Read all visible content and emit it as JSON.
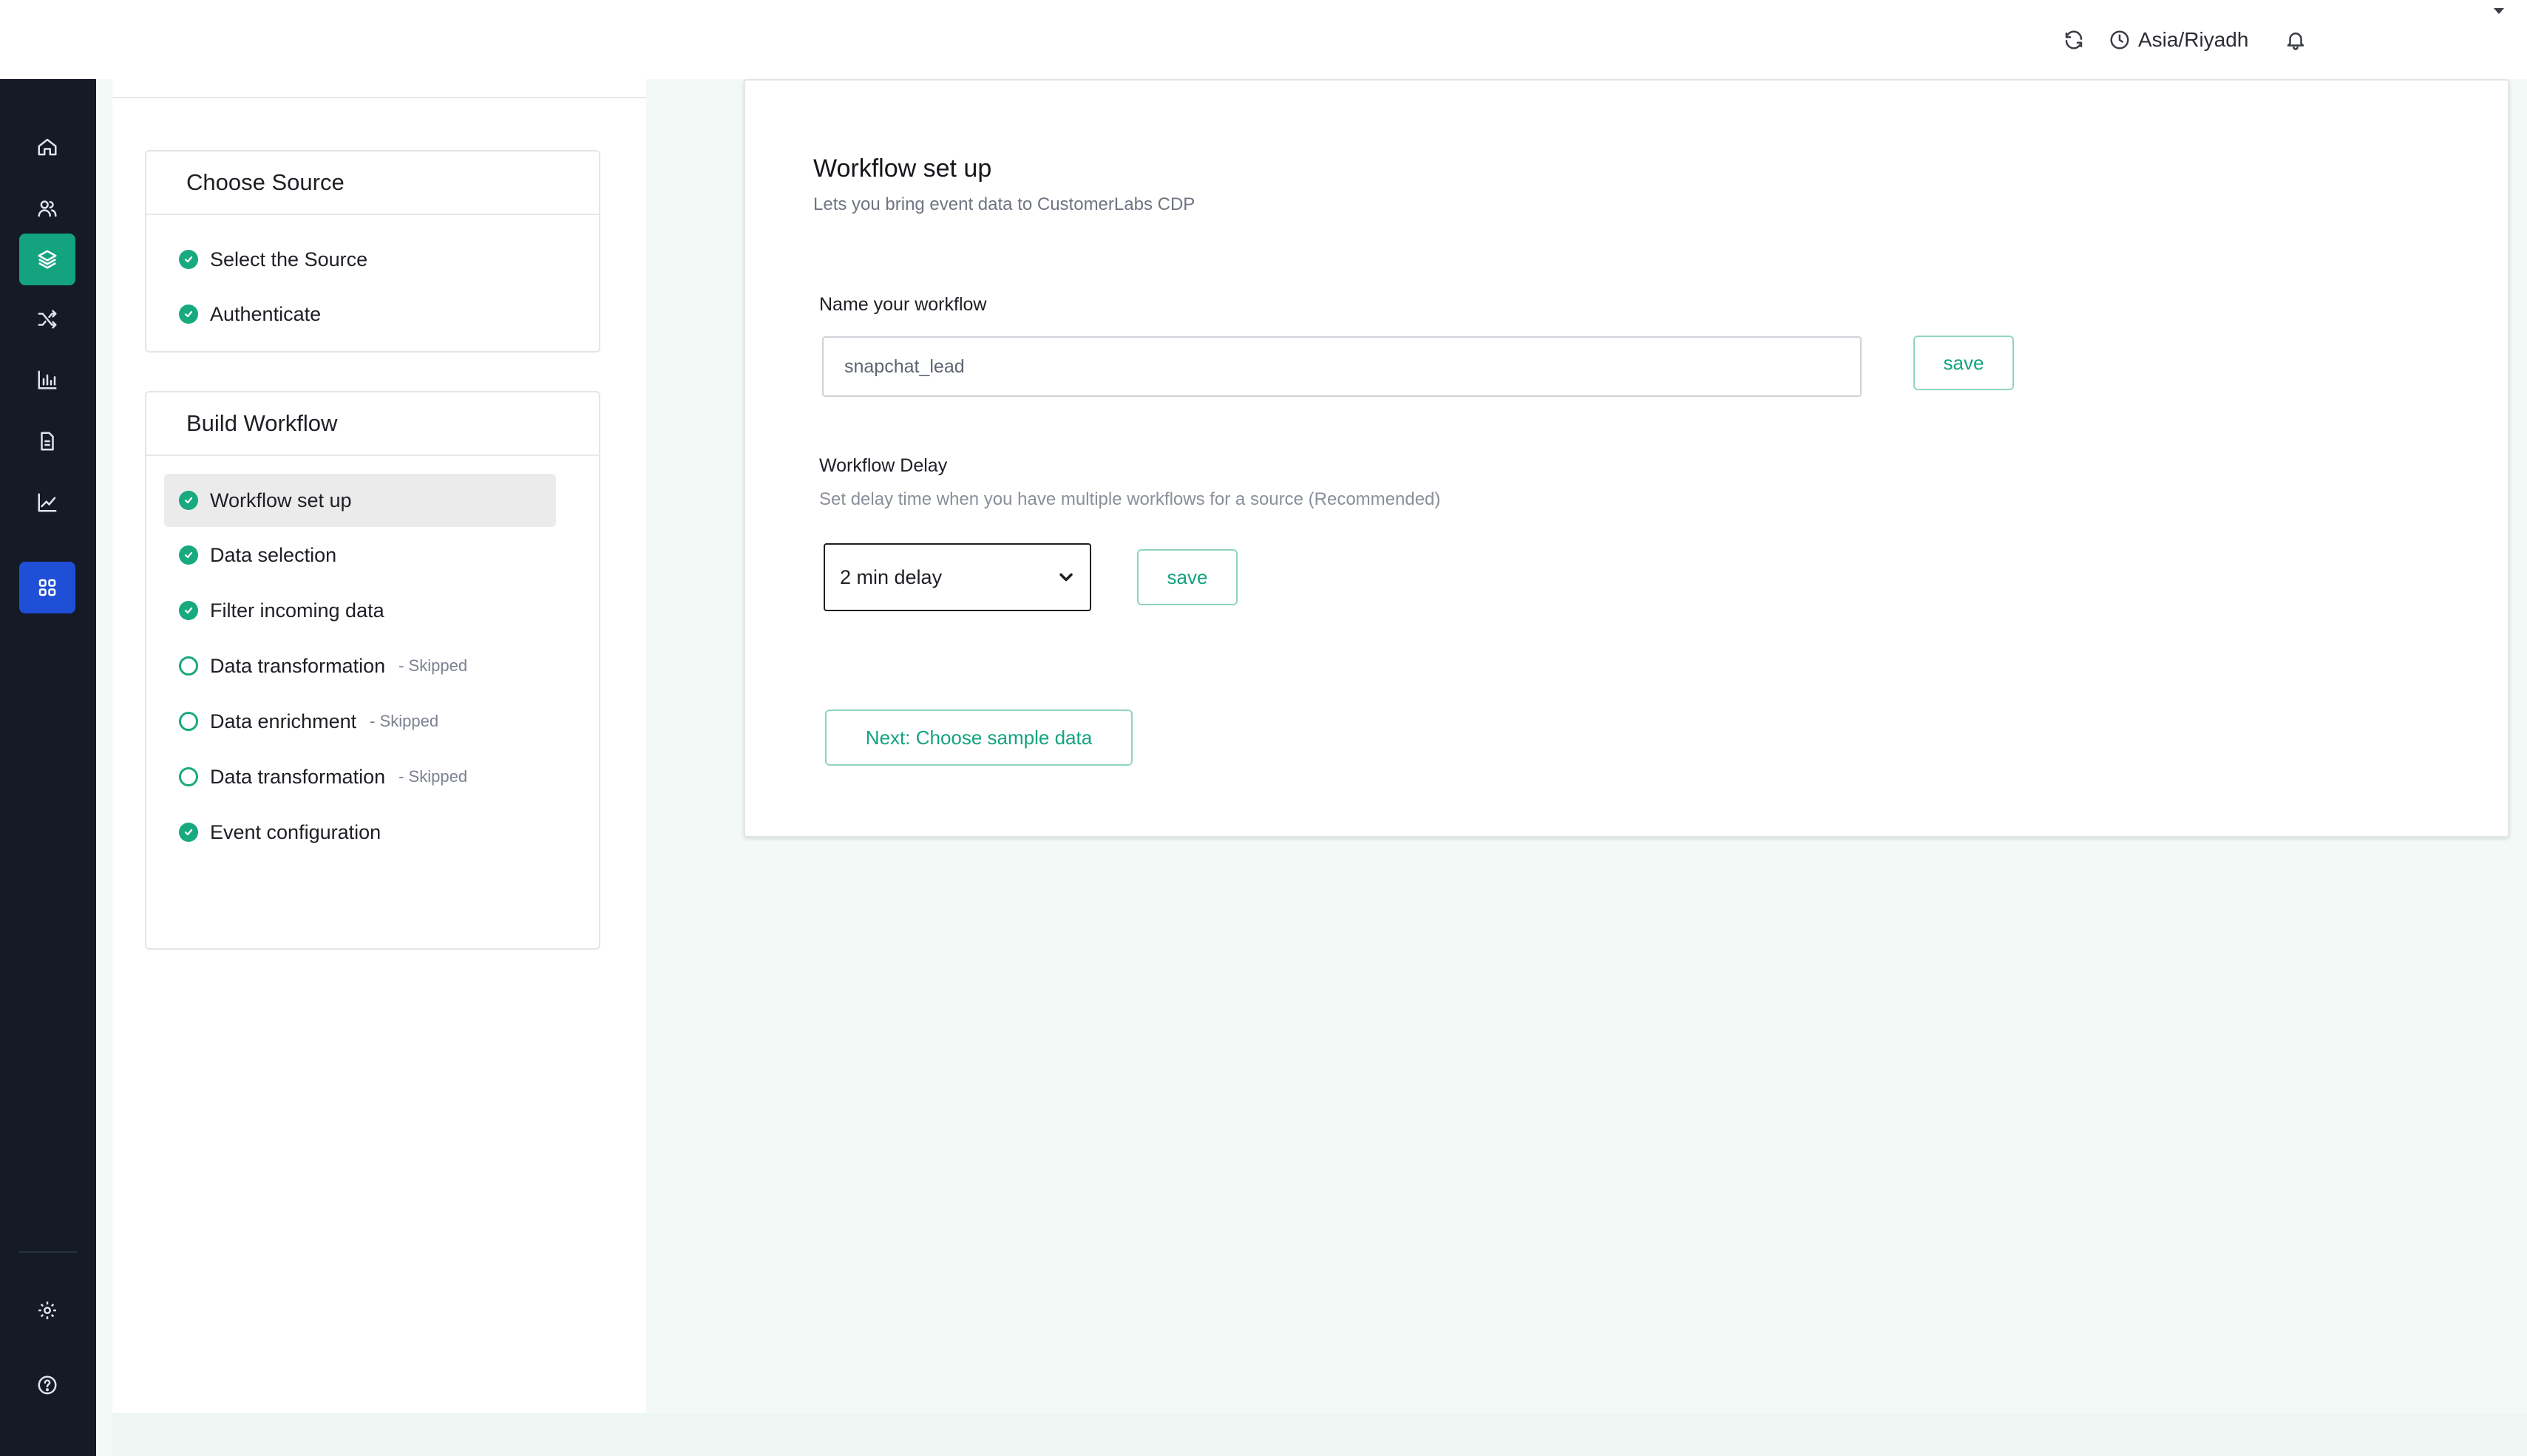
{
  "topbar": {
    "refresh_icon": "refresh-icon",
    "clock_icon": "clock-icon",
    "timezone": "Asia/Riyadh",
    "bell_icon": "bell-icon",
    "dropdown_icon": "caret-down-icon"
  },
  "nav": {
    "items": [
      {
        "icon": "home-icon",
        "active": false
      },
      {
        "icon": "users-icon",
        "active": false
      },
      {
        "icon": "layers-icon",
        "active": true,
        "color": "#13a37f"
      },
      {
        "icon": "shuffle-icon",
        "active": false
      },
      {
        "icon": "bar-chart-icon",
        "active": false
      },
      {
        "icon": "document-icon",
        "active": false
      },
      {
        "icon": "line-chart-icon",
        "active": false
      },
      {
        "icon": "grid-icon",
        "active": true,
        "color": "#1f4fd6"
      }
    ],
    "bottom": [
      {
        "icon": "gear-icon"
      },
      {
        "icon": "help-icon"
      }
    ]
  },
  "steps": {
    "choose_source": {
      "title": "Choose Source",
      "items": [
        {
          "label": "Select the Source",
          "status": "done"
        },
        {
          "label": "Authenticate",
          "status": "done"
        }
      ]
    },
    "build_workflow": {
      "title": "Build Workflow",
      "items": [
        {
          "label": "Workflow set up",
          "status": "done",
          "active": true,
          "note": ""
        },
        {
          "label": "Data selection",
          "status": "done",
          "note": ""
        },
        {
          "label": "Filter incoming data",
          "status": "done",
          "note": ""
        },
        {
          "label": "Data transformation",
          "status": "todo",
          "note": "- Skipped"
        },
        {
          "label": "Data enrichment",
          "status": "todo",
          "note": "- Skipped"
        },
        {
          "label": "Data transformation",
          "status": "todo",
          "note": "- Skipped"
        },
        {
          "label": "Event configuration",
          "status": "done",
          "note": ""
        }
      ]
    }
  },
  "main": {
    "title": "Workflow set up",
    "subtitle": "Lets you bring event data to CustomerLabs CDP",
    "name_label": "Name your workflow",
    "name_value": "snapchat_lead",
    "name_save": "save",
    "delay_label": "Workflow Delay",
    "delay_help": "Set delay time when you have multiple workflows for a source (Recommended)",
    "delay_value": "2 min delay",
    "delay_save": "save",
    "next_button": "Next: Choose sample data"
  },
  "colors": {
    "accent_green": "#13a37f",
    "accent_blue": "#1f4fd6",
    "nav_bg": "#141a26",
    "page_bg": "#f3f9f6"
  }
}
